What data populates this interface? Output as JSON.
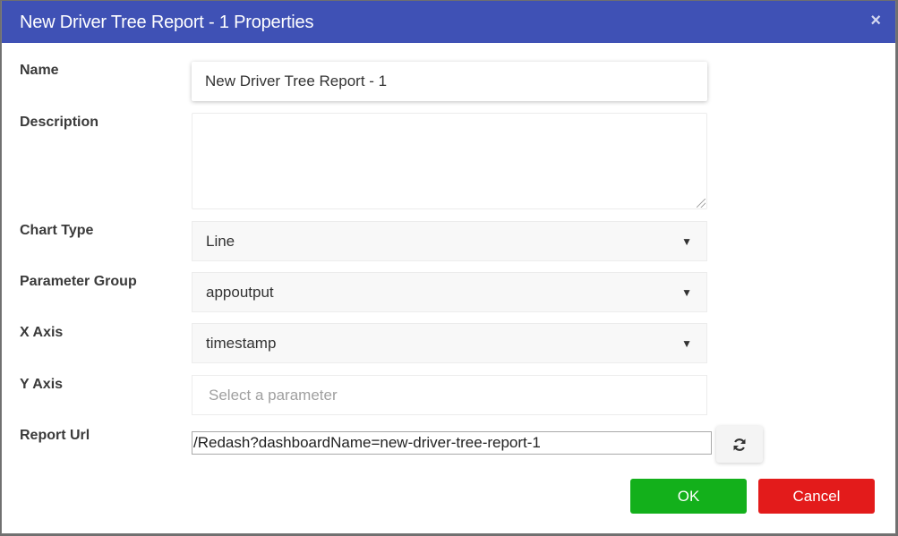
{
  "dialog": {
    "title": "New Driver Tree Report - 1 Properties",
    "close_icon": "×"
  },
  "form": {
    "name": {
      "label": "Name",
      "value": "New Driver Tree Report - 1"
    },
    "description": {
      "label": "Description",
      "value": ""
    },
    "chart_type": {
      "label": "Chart Type",
      "value": "Line"
    },
    "parameter_group": {
      "label": "Parameter Group",
      "value": "appoutput"
    },
    "x_axis": {
      "label": "X Axis",
      "value": "timestamp"
    },
    "y_axis": {
      "label": "Y Axis",
      "placeholder": "Select a parameter"
    },
    "report_url": {
      "label": "Report Url",
      "value": "/Redash?dashboardName=new-driver-tree-report-1"
    }
  },
  "icons": {
    "caret": "▼",
    "refresh": "refresh-icon"
  },
  "buttons": {
    "ok": "OK",
    "cancel": "Cancel"
  },
  "colors": {
    "header": "#3f51b5",
    "ok": "#13b01b",
    "cancel": "#e31b1b"
  }
}
